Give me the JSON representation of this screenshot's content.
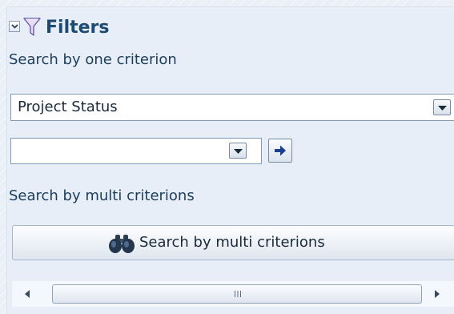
{
  "filters": {
    "title": "Filters",
    "collapse_icon": "chevron-down-icon",
    "header_icon": "funnel-icon"
  },
  "single_search": {
    "label": "Search by one criterion",
    "criterion_select": {
      "value": "Project Status",
      "icon": "dropdown-arrow-icon"
    },
    "value_select": {
      "value": "",
      "icon": "dropdown-arrow-icon"
    },
    "go_icon": "arrow-right-icon"
  },
  "multi_search": {
    "label": "Search by multi criterions",
    "button_label": "Search by multi criterions",
    "button_icon": "binoculars-icon"
  },
  "scrollbar": {
    "grip_label": "III"
  },
  "colors": {
    "panel_background": "#e7eef7",
    "title_text": "#1d4a72",
    "go_arrow": "#1a3f8f"
  }
}
